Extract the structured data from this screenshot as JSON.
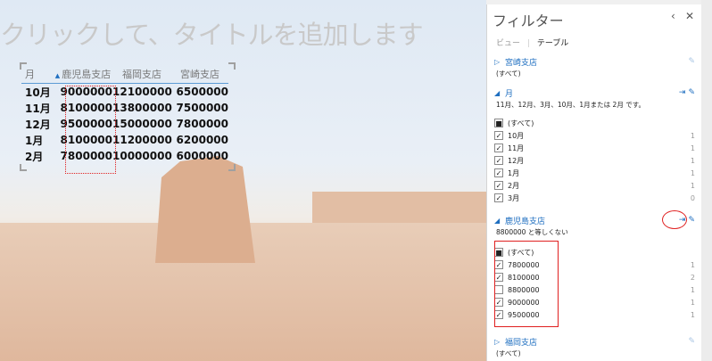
{
  "slide": {
    "title_placeholder": "クリックして、タイトルを追加します",
    "table": {
      "headers": [
        "月",
        "鹿児島支店",
        "福岡支店",
        "宮崎支店"
      ],
      "rows": [
        [
          "10月",
          "9000000",
          "12100000",
          "6500000"
        ],
        [
          "11月",
          "8100000",
          "13800000",
          "7500000"
        ],
        [
          "12月",
          "9500000",
          "15000000",
          "7800000"
        ],
        [
          "1月",
          "8100000",
          "11200000",
          "6200000"
        ],
        [
          "2月",
          "7800000",
          "10000000",
          "6000000"
        ]
      ]
    }
  },
  "panel": {
    "title": "フィルター",
    "tabs": [
      "ビュー",
      "テーブル"
    ],
    "sections": [
      {
        "name": "宮崎支店",
        "desc": "(すべて)",
        "expanded": false
      },
      {
        "name": "月",
        "desc": "11月、12月、3月、10月、1月または 2月 です。",
        "expanded": true,
        "items": [
          {
            "label": "(すべて)",
            "state": "partial",
            "count": ""
          },
          {
            "label": "10月",
            "state": "checked",
            "count": "1"
          },
          {
            "label": "11月",
            "state": "checked",
            "count": "1"
          },
          {
            "label": "12月",
            "state": "checked",
            "count": "1"
          },
          {
            "label": "1月",
            "state": "checked",
            "count": "1"
          },
          {
            "label": "2月",
            "state": "checked",
            "count": "1"
          },
          {
            "label": "3月",
            "state": "checked",
            "count": "0"
          }
        ]
      },
      {
        "name": "鹿児島支店",
        "desc": "8800000 と等しくない",
        "expanded": true,
        "items": [
          {
            "label": "(すべて)",
            "state": "partial",
            "count": ""
          },
          {
            "label": "7800000",
            "state": "checked",
            "count": "1"
          },
          {
            "label": "8100000",
            "state": "checked",
            "count": "2"
          },
          {
            "label": "8800000",
            "state": "unchecked",
            "count": "1"
          },
          {
            "label": "9000000",
            "state": "checked",
            "count": "1"
          },
          {
            "label": "9500000",
            "state": "checked",
            "count": "1"
          }
        ]
      },
      {
        "name": "福岡支店",
        "desc": "(すべて)",
        "expanded": false
      }
    ]
  }
}
